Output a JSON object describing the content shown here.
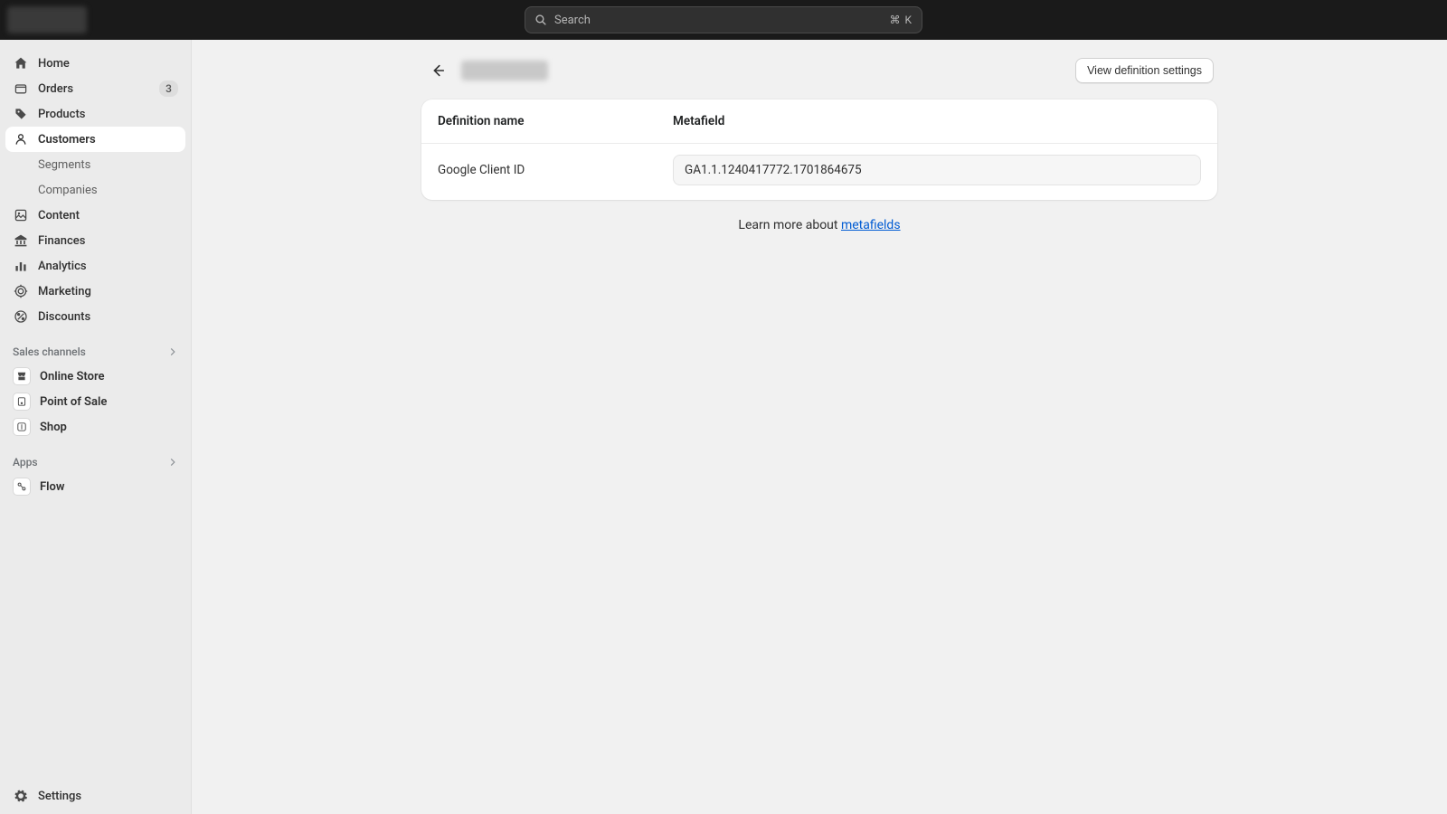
{
  "topbar": {
    "search_placeholder": "Search",
    "shortcut": "⌘ K"
  },
  "sidebar": {
    "items": [
      {
        "label": "Home",
        "icon": "home"
      },
      {
        "label": "Orders",
        "icon": "orders",
        "badge": "3"
      },
      {
        "label": "Products",
        "icon": "tag"
      },
      {
        "label": "Customers",
        "icon": "person",
        "active": true
      },
      {
        "label": "Content",
        "icon": "content"
      },
      {
        "label": "Finances",
        "icon": "bank"
      },
      {
        "label": "Analytics",
        "icon": "bars"
      },
      {
        "label": "Marketing",
        "icon": "target"
      },
      {
        "label": "Discounts",
        "icon": "discount"
      }
    ],
    "customers_sub": [
      {
        "label": "Segments"
      },
      {
        "label": "Companies"
      }
    ],
    "sections": {
      "sales": "Sales channels",
      "apps": "Apps"
    },
    "channels": [
      {
        "label": "Online Store"
      },
      {
        "label": "Point of Sale"
      },
      {
        "label": "Shop"
      }
    ],
    "apps": [
      {
        "label": "Flow"
      }
    ],
    "settings": "Settings"
  },
  "page": {
    "view_button": "View definition settings",
    "columns": {
      "name": "Definition name",
      "meta": "Metafield"
    },
    "rows": [
      {
        "name": "Google Client ID",
        "value": "GA1.1.1240417772.1701864675"
      }
    ],
    "learn_prefix": "Learn more about ",
    "learn_link": "metafields"
  }
}
